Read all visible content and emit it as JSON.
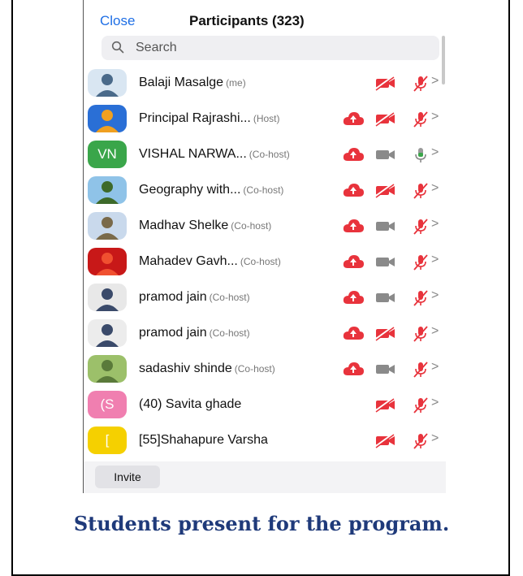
{
  "header": {
    "close_label": "Close",
    "title": "Participants (323)"
  },
  "search": {
    "placeholder": "Search"
  },
  "participants": [
    {
      "name": "Balaji Masalge",
      "role": "(me)",
      "avatar": "photo",
      "host_cloud": false,
      "video": "off",
      "mic": "muted"
    },
    {
      "name": "Principal Rajrashi...",
      "role": "(Host)",
      "avatar": "photo",
      "host_cloud": true,
      "video": "off",
      "mic": "muted"
    },
    {
      "name": "VISHAL NARWA...",
      "role": "(Co-host)",
      "avatar_initials": "VN",
      "avatar_color": "#3aa64a",
      "host_cloud": true,
      "video": "on",
      "mic": "unmuted"
    },
    {
      "name": "Geography with...",
      "role": "(Co-host)",
      "avatar": "photo",
      "host_cloud": true,
      "video": "off",
      "mic": "muted"
    },
    {
      "name": "Madhav Shelke",
      "role": "(Co-host)",
      "avatar": "photo",
      "host_cloud": true,
      "video": "on",
      "mic": "muted"
    },
    {
      "name": "Mahadev Gavh...",
      "role": "(Co-host)",
      "avatar": "photo",
      "host_cloud": true,
      "video": "on",
      "mic": "muted"
    },
    {
      "name": "pramod jain",
      "role": "(Co-host)",
      "avatar": "photo",
      "host_cloud": true,
      "video": "on",
      "mic": "muted"
    },
    {
      "name": "pramod jain",
      "role": "(Co-host)",
      "avatar": "photo",
      "host_cloud": true,
      "video": "off",
      "mic": "muted"
    },
    {
      "name": "sadashiv shinde",
      "role": "(Co-host)",
      "avatar": "photo",
      "host_cloud": true,
      "video": "on",
      "mic": "muted"
    },
    {
      "name": "(40) Savita ghade",
      "role": "",
      "avatar_initials": "(S",
      "avatar_color": "#f07fb0",
      "host_cloud": false,
      "video": "off",
      "mic": "muted"
    },
    {
      "name": "[55]Shahapure  Varsha",
      "role": "",
      "avatar_initials": "[",
      "avatar_color": "#f5d000",
      "host_cloud": false,
      "video": "off",
      "mic": "muted"
    }
  ],
  "footer": {
    "invite_label": "Invite"
  },
  "caption": "Students present for the program.",
  "colors": {
    "accent": "#1f6fe5",
    "muted_red": "#e8333c",
    "unmuted_green": "#3aa64a",
    "caption": "#1f3a7a"
  }
}
